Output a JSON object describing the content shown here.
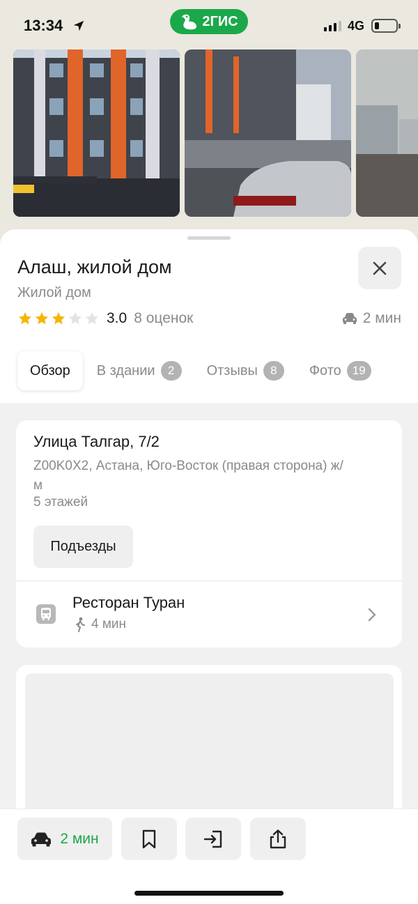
{
  "status_bar": {
    "time": "13:34",
    "network": "4G",
    "brand": "2ГИС"
  },
  "place": {
    "title": "Алаш, жилой дом",
    "category": "Жилой дом",
    "rating": {
      "value": "3.0",
      "stars": 3,
      "max_stars": 5,
      "count_label": "8 оценок"
    },
    "eta": "2 мин"
  },
  "tabs": [
    {
      "label": "Обзор",
      "badge": ""
    },
    {
      "label": "В здании",
      "badge": "2"
    },
    {
      "label": "Отзывы",
      "badge": "8"
    },
    {
      "label": "Фото",
      "badge": "19"
    }
  ],
  "address_card": {
    "street": "Улица Талгар, 7/2",
    "details": "Z00K0X2, Астана, Юго-Восток (правая сторона) ж/м",
    "floors": "5 этажей",
    "entrances_button": "Подъезды",
    "nearby": {
      "name": "Ресторан Туран",
      "walk_time": "4 мин"
    }
  },
  "bottom_bar": {
    "route_label": "2 мин"
  },
  "colors": {
    "brand_green": "#1aa84a",
    "star": "#f5b500",
    "star_empty": "#e3e3e3"
  }
}
